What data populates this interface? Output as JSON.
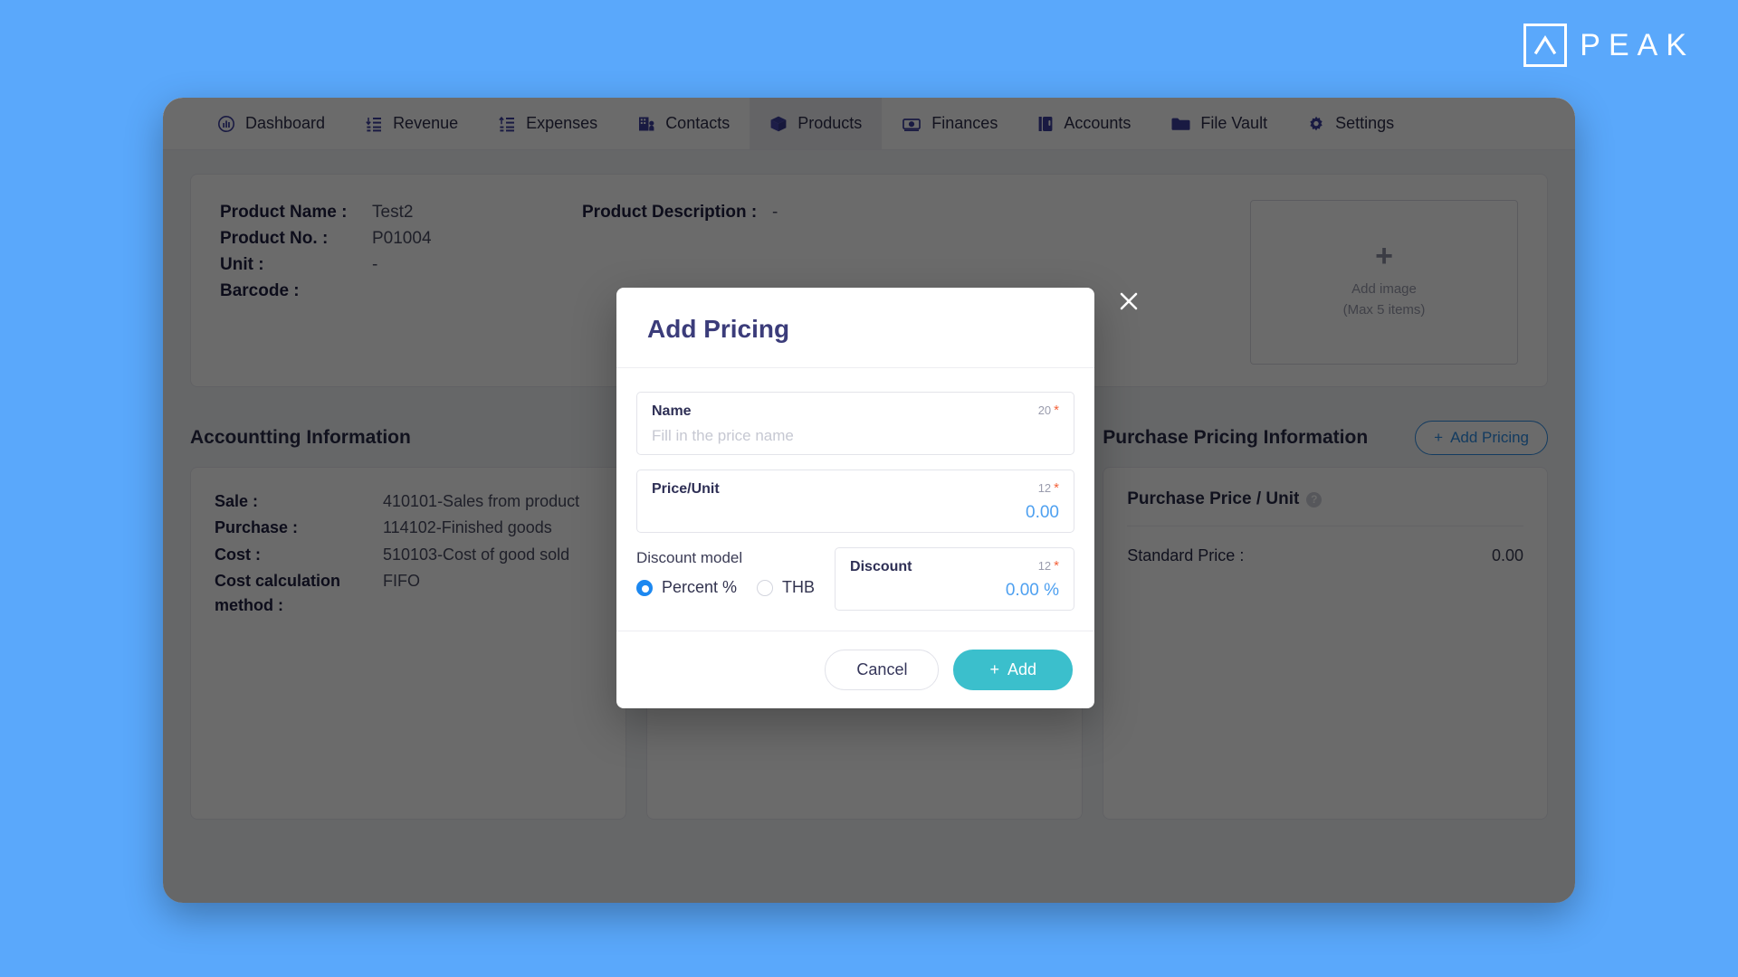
{
  "brand": {
    "name": "PEAK",
    "mark_icon": "peak-chevron-mark"
  },
  "nav": {
    "items": [
      {
        "label": "Dashboard",
        "icon": "dashboard-gauge-icon",
        "active": false
      },
      {
        "label": "Revenue",
        "icon": "revenue-down-list-icon",
        "active": false
      },
      {
        "label": "Expenses",
        "icon": "expenses-up-list-icon",
        "active": false
      },
      {
        "label": "Contacts",
        "icon": "contacts-building-icon",
        "active": false
      },
      {
        "label": "Products",
        "icon": "products-box-icon",
        "active": true
      },
      {
        "label": "Finances",
        "icon": "finances-money-icon",
        "active": false
      },
      {
        "label": "Accounts",
        "icon": "accounts-book-icon",
        "active": false
      },
      {
        "label": "File Vault",
        "icon": "file-vault-folder-icon",
        "active": false
      },
      {
        "label": "Settings",
        "icon": "settings-gear-icon",
        "active": false
      }
    ]
  },
  "product": {
    "fields_left": [
      {
        "label": "Product Name :",
        "value": "Test2"
      },
      {
        "label": "Product No. :",
        "value": "P01004"
      },
      {
        "label": "Unit :",
        "value": "-"
      },
      {
        "label": "Barcode :",
        "value": ""
      }
    ],
    "fields_right": [
      {
        "label": "Product Description :",
        "value": "-"
      }
    ],
    "image_drop": {
      "plus": "+",
      "line1": "Add image",
      "line2": "(Max 5 items)"
    }
  },
  "accounting": {
    "title": "Accountting Information",
    "rows": [
      {
        "label": "Sale :",
        "value": "410101-Sales from product"
      },
      {
        "label": "Purchase :",
        "value": "114102-Finished goods"
      },
      {
        "label": "Cost :",
        "value": "510103-Cost of good sold"
      },
      {
        "label": "Cost calculation method :",
        "value": "FIFO"
      }
    ]
  },
  "sale_pricing": {
    "title": ""
  },
  "purchase_pricing": {
    "title": "Purchase Pricing Information",
    "add_button": "Add Pricing",
    "add_icon": "plus-icon",
    "column_header": "Purchase Price / Unit",
    "help_icon": "help-circle-icon",
    "rows": [
      {
        "label": "Standard Price :",
        "value": "0.00"
      }
    ]
  },
  "modal": {
    "title": "Add Pricing",
    "close_icon": "close-icon",
    "name_field": {
      "label": "Name",
      "counter": "20",
      "required_mark": "*",
      "placeholder": "Fill in the price name",
      "value": ""
    },
    "price_field": {
      "label": "Price/Unit",
      "counter": "12",
      "required_mark": "*",
      "value": "0.00"
    },
    "discount_model": {
      "title": "Discount model",
      "options": [
        {
          "label": "Percent %",
          "selected": true
        },
        {
          "label": "THB",
          "selected": false
        }
      ]
    },
    "discount_field": {
      "label": "Discount",
      "counter": "12",
      "required_mark": "*",
      "value": "0.00 %"
    },
    "cancel_label": "Cancel",
    "add_label": "Add",
    "add_icon": "plus-icon"
  },
  "colors": {
    "page_bg": "#5aa8fb",
    "nav_icon": "#3d3f9e",
    "accent_blue": "#2f8de4",
    "value_blue": "#4ea0f0",
    "radio_blue": "#1d88f0",
    "required_red": "#f4623a",
    "add_teal": "#3bbfcc",
    "modal_title": "#3b3c7a"
  }
}
